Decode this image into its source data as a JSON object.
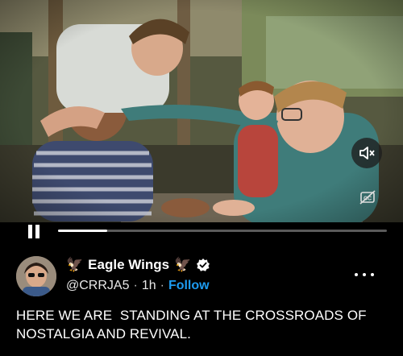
{
  "video": {
    "sound_icon": "speaker-muted-icon",
    "captions_icon": "captions-off-icon",
    "progress": 0.15,
    "pause_icon": "pause-icon"
  },
  "post": {
    "author": {
      "display_name": "Eagle Wings",
      "emoji_left": "🦅",
      "emoji_right": "🦅",
      "verified_icon": "verified-badge-icon",
      "handle": "@CRRJA5",
      "time": "1h",
      "separator": "·",
      "follow_label": "Follow"
    },
    "more_icon": "more-options-icon",
    "text_line1": "HERE WE ARE  STANDING AT THE CROSSROADS OF",
    "text_line2": "NOSTALGIA AND REVIVAL."
  },
  "colors": {
    "background": "#000000",
    "follow": "#1d9bf0",
    "progress_track": "#5a5a5a",
    "progress_fill": "#ffffff"
  }
}
